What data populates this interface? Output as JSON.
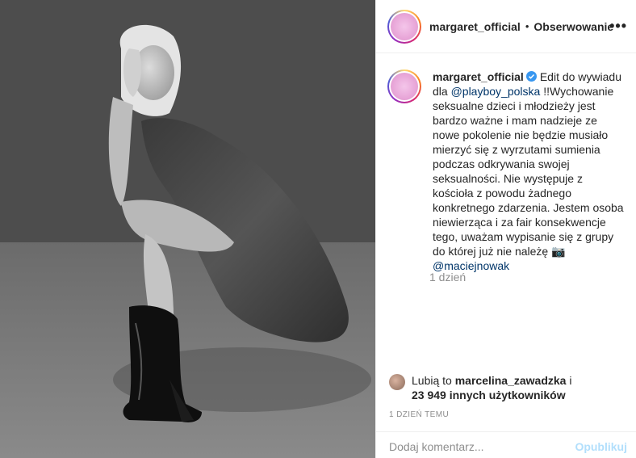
{
  "post": {
    "image_alt": "black-and-white photo of a woman in a dark dress and black platform boots"
  },
  "header": {
    "username": "margaret_official",
    "separator": "•",
    "follow_label": "Obserwowanie",
    "more_label": "•••"
  },
  "caption": {
    "username": "margaret_official",
    "text_part1": "Edit do wywiadu dla ",
    "mention1": "@playboy_polska",
    "text_part2": " !!Wychowanie seksualne dzieci i młodzieży jest bardzo ważne i mam nadzieje ze nowe pokolenie nie będzie musiało mierzyć się z wyrzutami sumienia podczas odkrywania swojej seksualności. Nie występuje z kościoła z powodu żadnego konkretnego zdarzenia. Jestem osoba niewierząca i za fair konsekwencje tego, uważam wypisanie się z grupy do której już nie należę 📷 ",
    "mention2": "@maciejnowak",
    "time": "1 dzień"
  },
  "likes": {
    "prefix": "Lubią to ",
    "user": "marcelina_zawadzka",
    "connector": " i",
    "count_text": "23 949 innych użytkowników"
  },
  "posted": "1 DZIEŃ TEMU",
  "comment": {
    "placeholder": "Dodaj komentarz...",
    "publish_label": "Opublikuj"
  },
  "colors": {
    "link": "#003569",
    "muted": "#8e8e8e",
    "publish_disabled": "#b2dffc",
    "verified": "#3897f0"
  }
}
